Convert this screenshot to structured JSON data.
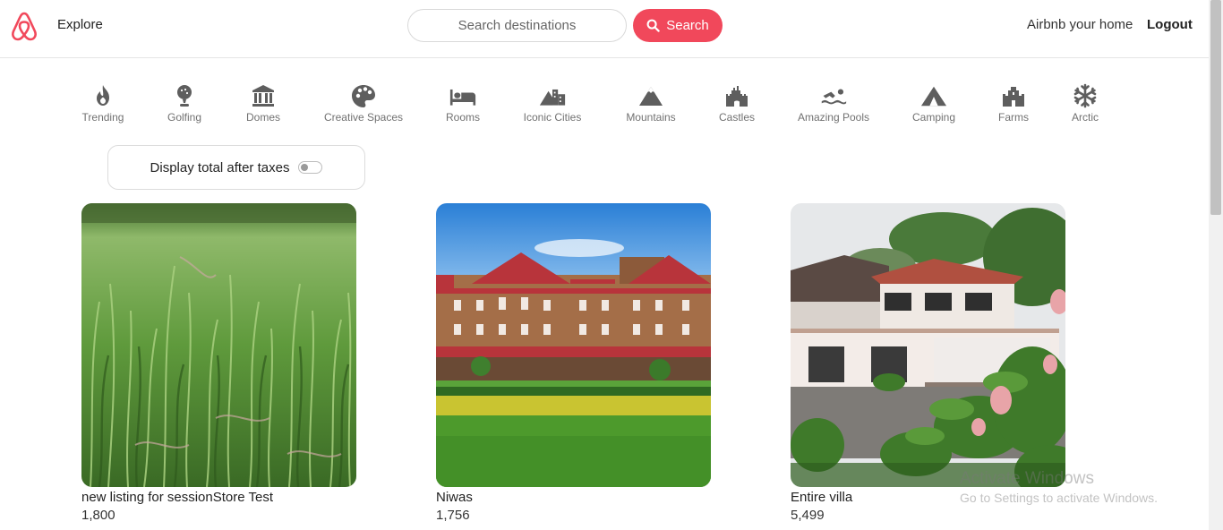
{
  "header": {
    "explore": "Explore",
    "search_placeholder": "Search destinations",
    "search_button": "Search",
    "host_link": "Airbnb your home",
    "logout": "Logout",
    "brand_color": "#f1485b"
  },
  "categories": [
    {
      "label": "Trending",
      "icon": "fire-icon"
    },
    {
      "label": "Golfing",
      "icon": "golf-icon"
    },
    {
      "label": "Domes",
      "icon": "dome-icon"
    },
    {
      "label": "Creative Spaces",
      "icon": "palette-icon"
    },
    {
      "label": "Rooms",
      "icon": "bed-icon"
    },
    {
      "label": "Iconic Cities",
      "icon": "city-icon"
    },
    {
      "label": "Mountains",
      "icon": "mountain-icon"
    },
    {
      "label": "Castles",
      "icon": "castle-icon"
    },
    {
      "label": "Amazing Pools",
      "icon": "swimmer-icon"
    },
    {
      "label": "Camping",
      "icon": "tent-icon"
    },
    {
      "label": "Farms",
      "icon": "farm-icon"
    },
    {
      "label": "Arctic",
      "icon": "snowflake-icon"
    }
  ],
  "tax_toggle": {
    "label": "Display total after taxes",
    "enabled": false
  },
  "listings": [
    {
      "title": "new listing for sessionStore Test",
      "price": "1,800"
    },
    {
      "title": "Niwas",
      "price": "1,756"
    },
    {
      "title": "Entire villa",
      "price": "5,499"
    }
  ],
  "watermark": {
    "line1": "Activate Windows",
    "line2": "Go to Settings to activate Windows."
  }
}
